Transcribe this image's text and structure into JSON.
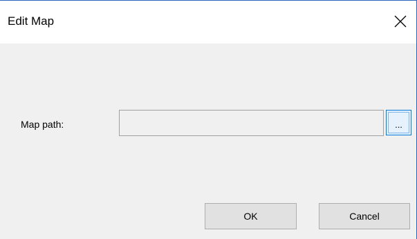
{
  "window": {
    "title": "Edit Map",
    "close_icon": "close-icon"
  },
  "form": {
    "map_path_label": "Map path:",
    "map_path_value": "",
    "browse_label": "..."
  },
  "buttons": {
    "ok_label": "OK",
    "cancel_label": "Cancel"
  },
  "colors": {
    "accent": "#0078d7",
    "window_border": "#2b63b8",
    "client_background": "#f0f0f0"
  }
}
